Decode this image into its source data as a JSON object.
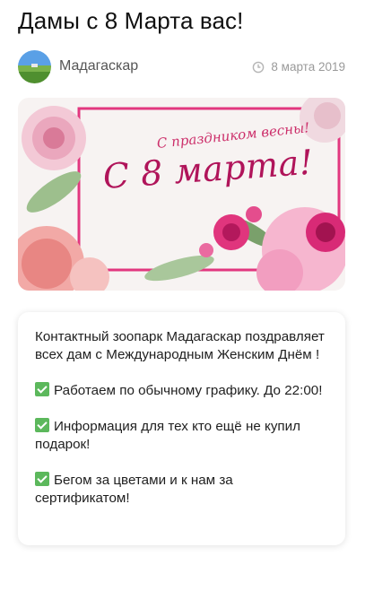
{
  "post": {
    "title": "Дамы с 8 Марта вас!",
    "author": "Мадагаскар",
    "date": "8 марта 2019"
  },
  "banner": {
    "subtitle": "С праздником весны!",
    "headline": "С 8 марта!"
  },
  "content": {
    "intro": "Контактный зоопарк Мадагаскар поздравляет всех дам с Международным Женским Днём !",
    "items": [
      "Работаем по обычному графику. До 22:00!",
      "Информация для тех кто ещё не купил подарок!",
      "Бегом за цветами и к нам за сертификатом!"
    ],
    "bullet_icon": "check-mark-button-emoji"
  },
  "colors": {
    "banner_text": "#b0145a",
    "check": "#5cb85c"
  }
}
